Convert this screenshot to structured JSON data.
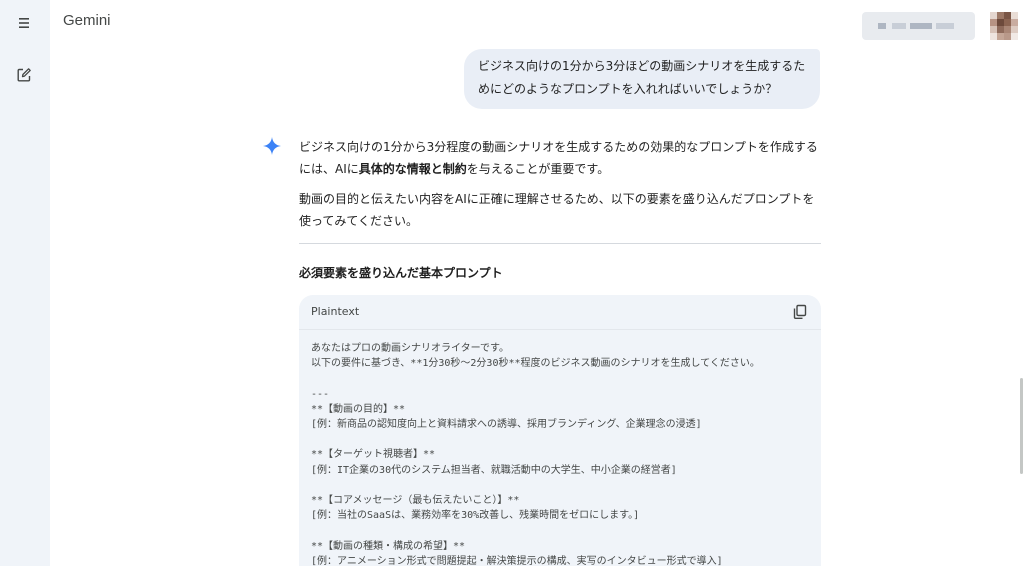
{
  "app": {
    "title": "Gemini"
  },
  "icons": {
    "menu": "menu-icon",
    "new_chat": "edit-square-icon",
    "spark": "gemini-spark-icon",
    "copy": "copy-icon"
  },
  "colors": {
    "rail_bg": "#f0f4f9",
    "user_bubble_bg": "#e9eef6",
    "code_bg": "#f0f4f9",
    "spark_blue": "#3b82f6"
  },
  "user_message": {
    "text": "ビジネス向けの1分から3分ほどの動画シナリオを生成するためにどのようなプロンプトを入れればいいでしょうか？"
  },
  "response": {
    "p1_a": "ビジネス向けの1分から3分程度の動画シナリオを生成するための効果的なプロンプトを作成するには、AIに",
    "p1_bold": "具体的な情報と制約",
    "p1_b": "を与えることが重要です。",
    "p2": "動画の目的と伝えたい内容をAIに正確に理解させるため、以下の要素を盛り込んだプロンプトを使ってみてください。",
    "section_heading": "必須要素を盛り込んだ基本プロンプト"
  },
  "code_block": {
    "language": "Plaintext",
    "lines": [
      "あなたはプロの動画シナリオライターです。",
      "以下の要件に基づき、**1分30秒〜2分30秒**程度のビジネス動画のシナリオを生成してください。",
      "",
      "---",
      "**【動画の目的】**",
      "[例：新商品の認知度向上と資料請求への誘導、採用ブランディング、企業理念の浸透]",
      "",
      "**【ターゲット視聴者】**",
      "[例：IT企業の30代のシステム担当者、就職活動中の大学生、中小企業の経営者]",
      "",
      "**【コアメッセージ（最も伝えたいこと）】**",
      "[例：当社のSaaSは、業務効率を30%改善し、残業時間をゼロにします。]",
      "",
      "**【動画の種類・構成の希望】**",
      "[例：アニメーション形式で問題提起・解決策提示の構成、実写のインタビュー形式で導入]"
    ]
  }
}
